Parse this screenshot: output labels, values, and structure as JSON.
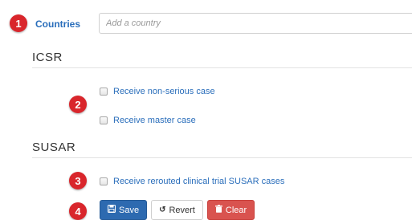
{
  "badges": {
    "b1": "1",
    "b2": "2",
    "b3": "3",
    "b4": "4"
  },
  "countries": {
    "label": "Countries",
    "placeholder": "Add a country"
  },
  "icsr": {
    "title": "ICSR",
    "options": [
      {
        "label": "Receive non-serious case",
        "checked": false
      },
      {
        "label": "Receive master case",
        "checked": false
      }
    ]
  },
  "susar": {
    "title": "SUSAR",
    "options": [
      {
        "label": "Receive rerouted clinical trial SUSAR cases",
        "checked": false
      }
    ]
  },
  "actions": {
    "save_label": "Save",
    "revert_label": "Revert",
    "clear_label": "Clear",
    "save_icon": "floppy-disk-icon",
    "revert_icon": "undo-icon",
    "clear_icon": "trash-icon"
  },
  "colors": {
    "badge": "#d9262c",
    "link": "#2a6ebb",
    "save": "#2d6ab0",
    "clear": "#d9534f"
  }
}
